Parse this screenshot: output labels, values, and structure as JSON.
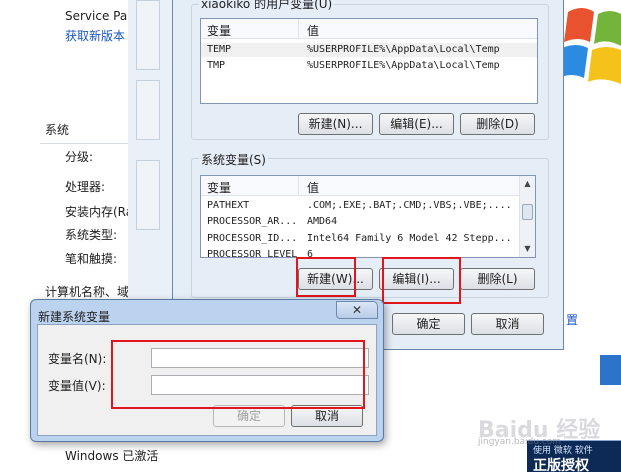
{
  "background": {
    "service_pack": "Service Pa",
    "get_new_version": "获取新版本",
    "section_system": "系统",
    "rating": "分级:",
    "processor": "处理器:",
    "installed_ram": "安装内存(Ra",
    "system_type": "系统类型:",
    "pen_touch": "笔和触摸:",
    "computer_name": "计算机名称、域",
    "side_link": "置",
    "windows_activated": "Windows 已激活",
    "genuine_top": "使用 微软 软件",
    "genuine_main": "正版授权"
  },
  "env_dialog": {
    "user_vars_title": "xiaokiko 的用户变量(U)",
    "col_variable": "变量",
    "col_value": "值",
    "user_vars": [
      {
        "name": "TEMP",
        "value": "%USERPROFILE%\\AppData\\Local\\Temp"
      },
      {
        "name": "TMP",
        "value": "%USERPROFILE%\\AppData\\Local\\Temp"
      }
    ],
    "user_new": "新建(N)...",
    "user_edit": "编辑(E)...",
    "user_delete": "删除(D)",
    "system_vars_title": "系统变量(S)",
    "system_vars": [
      {
        "name": "PATHEXT",
        "value": ".COM;.EXE;.BAT;.CMD;.VBS;.VBE;...."
      },
      {
        "name": "PROCESSOR_AR...",
        "value": "AMD64"
      },
      {
        "name": "PROCESSOR_ID...",
        "value": "Intel64 Family 6 Model 42 Stepp..."
      },
      {
        "name": "PROCESSOR_LEVEL",
        "value": "6"
      }
    ],
    "sys_new": "新建(W)...",
    "sys_edit": "编辑(I)...",
    "sys_delete": "删除(L)",
    "ok": "确定",
    "cancel": "取消"
  },
  "new_var_dialog": {
    "title": "新建系统变量",
    "close_glyph": "✕",
    "name_label": "变量名(N):",
    "value_label": "变量值(V):",
    "name_value": "",
    "value_value": "",
    "ok": "确定",
    "cancel": "取消"
  },
  "watermark": {
    "logo": "Baidu 经验",
    "url": "jingyan.baidu.com"
  }
}
